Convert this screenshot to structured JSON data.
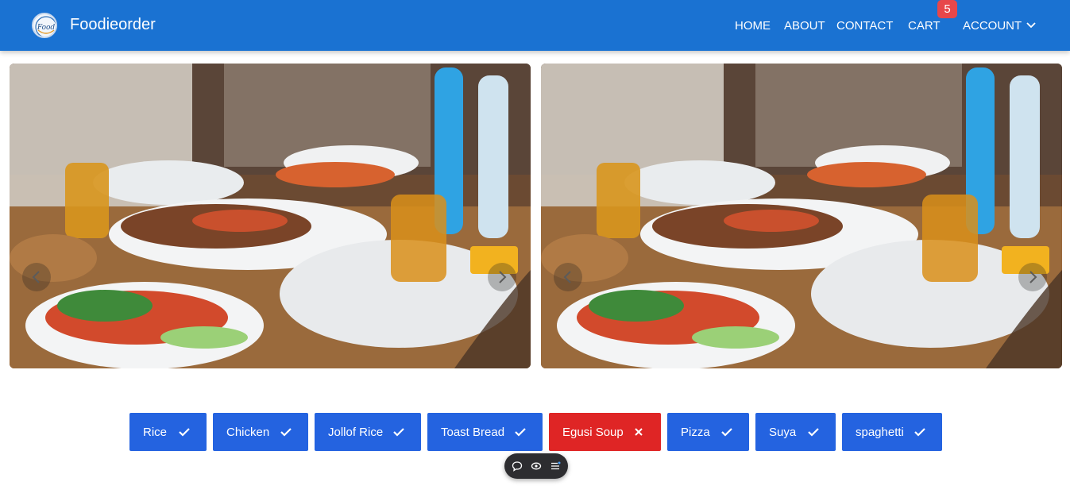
{
  "header": {
    "brand": "Foodieorder",
    "logo_text": "Food",
    "nav": {
      "home": "HOME",
      "about": "ABOUT",
      "contact": "CONTACT",
      "cart": "CART",
      "account": "ACCOUNT"
    },
    "cart_count": "5",
    "colors": {
      "bar": "#1a72d2",
      "badge": "#e7474a"
    }
  },
  "carousels": [
    {
      "slide_count": 5,
      "active_slide": 1,
      "prev_icon": "chevron-left-icon",
      "next_icon": "chevron-right-icon"
    },
    {
      "slide_count": 5,
      "active_slide": 1,
      "prev_icon": "chevron-left-icon",
      "next_icon": "chevron-right-icon"
    }
  ],
  "categories": [
    {
      "label": "Rice",
      "state": "selected",
      "icon": "check-icon"
    },
    {
      "label": "Chicken",
      "state": "selected",
      "icon": "check-icon"
    },
    {
      "label": "Jollof Rice",
      "state": "selected",
      "icon": "check-icon"
    },
    {
      "label": "Toast Bread",
      "state": "selected",
      "icon": "check-icon"
    },
    {
      "label": "Egusi Soup",
      "state": "removed",
      "icon": "close-icon"
    },
    {
      "label": "Pizza",
      "state": "selected",
      "icon": "check-icon"
    },
    {
      "label": "Suya",
      "state": "selected",
      "icon": "check-icon"
    },
    {
      "label": "spaghetti",
      "state": "selected",
      "icon": "check-icon"
    }
  ],
  "chip_colors": {
    "selected": "#2463e0",
    "removed": "#df2525"
  },
  "toolbar": {
    "icons": [
      "comment-icon",
      "eye-icon",
      "list-icon"
    ]
  }
}
